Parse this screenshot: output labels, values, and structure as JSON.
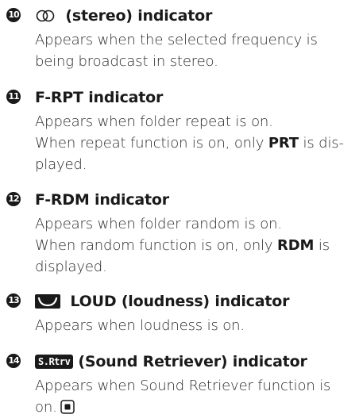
{
  "entries": [
    {
      "number": "10",
      "title": "(stereo) indicator",
      "icon": "stereo-icon",
      "lines": [
        "Appears when the selected frequency is",
        "being broadcast in stereo."
      ]
    },
    {
      "number": "11",
      "title": "F-RPT indicator",
      "lines": [
        "Appears when folder repeat is on.",
        "When repeat function is on, only",
        "PRT",
        " is dis-",
        "played."
      ]
    },
    {
      "number": "12",
      "title": "F-RDM indicator",
      "lines": [
        "Appears when folder random is on.",
        "When random function is on, only",
        "RDM",
        " is",
        "displayed."
      ]
    },
    {
      "number": "13",
      "title": "LOUD (loudness) indicator",
      "icon": "loudness-icon",
      "lines": [
        "Appears when loudness is on."
      ]
    },
    {
      "number": "14",
      "title": "(Sound Retriever) indicator",
      "icon_label": "S.Rtrv",
      "lines": [
        "Appears when Sound Retriever function is",
        "on."
      ]
    }
  ]
}
